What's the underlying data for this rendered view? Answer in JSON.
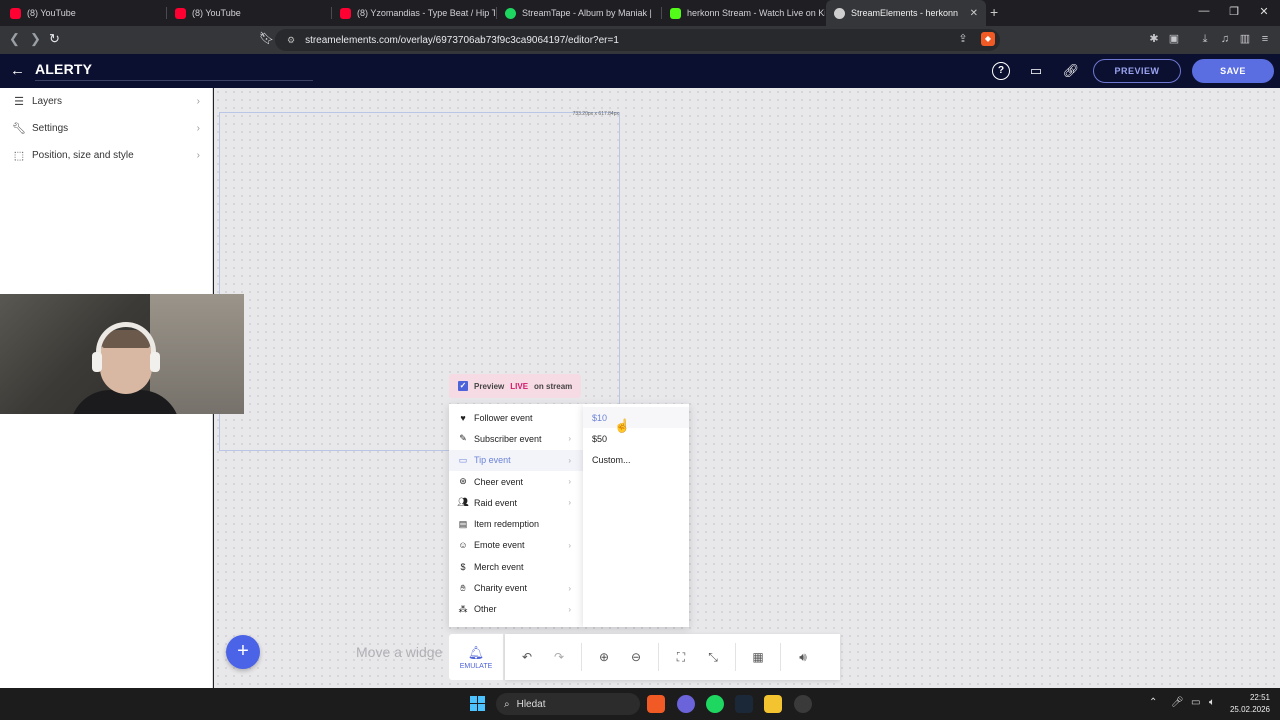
{
  "browser": {
    "tabs": [
      {
        "title": "(8) YouTube",
        "favicon_color": "#ff0033"
      },
      {
        "title": "(8) YouTube",
        "favicon_color": "#ff0033"
      },
      {
        "title": "(8) Yzomandias - Type Beat / Hip Thr",
        "favicon_color": "#ff0033"
      },
      {
        "title": "StreamTape - Album by Maniak |",
        "favicon_color": "#1ed760"
      },
      {
        "title": "herkonn Stream - Watch Live on Kick",
        "favicon_color": "#53fc18"
      },
      {
        "title": "StreamElements - herkonn",
        "favicon_color": "#cfcfcf",
        "active": true
      }
    ],
    "url": "streamelements.com/overlay/6973706ab73f9c3ca9064197/editor?er=1"
  },
  "header": {
    "title": "ALERTY",
    "preview_label": "PREVIEW",
    "save_label": "SAVE"
  },
  "sidebar": {
    "items": [
      {
        "label": "Layers",
        "icon": "layers-icon"
      },
      {
        "label": "Settings",
        "icon": "wrench-icon"
      },
      {
        "label": "Position, size and style",
        "icon": "selection-icon"
      }
    ]
  },
  "canvas": {
    "widget_size": "733.20px x 617.84px",
    "hint": "Move a widge"
  },
  "preview_live": {
    "prefix": "Preview",
    "live": "LIVE",
    "suffix": "on stream",
    "checked": true
  },
  "emulate_menu": {
    "items": [
      {
        "label": "Follower event",
        "icon": "heart-icon",
        "submenu": false
      },
      {
        "label": "Subscriber event",
        "icon": "subscriber-icon",
        "submenu": true
      },
      {
        "label": "Tip event",
        "icon": "card-icon",
        "submenu": true,
        "highlighted": true
      },
      {
        "label": "Cheer event",
        "icon": "cheer-icon",
        "submenu": true
      },
      {
        "label": "Raid event",
        "icon": "raid-icon",
        "submenu": true
      },
      {
        "label": "Item redemption",
        "icon": "item-icon",
        "submenu": false
      },
      {
        "label": "Emote event",
        "icon": "emote-icon",
        "submenu": true
      },
      {
        "label": "Merch event",
        "icon": "dollar-icon",
        "submenu": false
      },
      {
        "label": "Charity event",
        "icon": "charity-icon",
        "submenu": true
      },
      {
        "label": "Other",
        "icon": "other-icon",
        "submenu": true
      }
    ],
    "amounts": [
      {
        "label": "$10",
        "highlighted": true
      },
      {
        "label": "$50"
      },
      {
        "label": "Custom..."
      }
    ]
  },
  "toolbar": {
    "emulate_label": "EMULATE"
  },
  "taskbar": {
    "search_placeholder": "Hledat",
    "time": "22:51",
    "date": "25.02.2026"
  },
  "colors": {
    "accent": "#4e63d9",
    "header_bg": "#0c1030",
    "save": "#5b6ee1",
    "live": "#d0196b"
  }
}
